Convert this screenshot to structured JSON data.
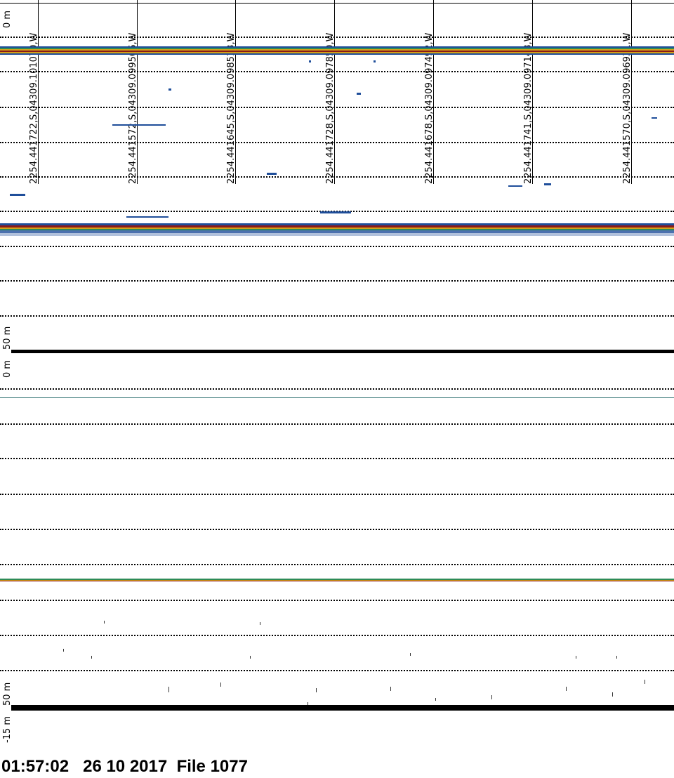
{
  "panel_top": {
    "depth_top_label": "0  m",
    "depth_bottom_label": "50  m"
  },
  "panel_bottom": {
    "depth_top_label": "0  m",
    "depth_bottom_label": "50  m",
    "offset_label": "-15  m"
  },
  "gps_marks": [
    "2254.441722,S,04309.101070,W",
    "2254.441572,S,04309.099566,W",
    "2254.441645,S,04309.098513,W",
    "2254.441728,S,04309.097850,W",
    "2254.441678,S,04309.097492,W",
    "2254.441741,S,04309.097148,W",
    "2254.441570,S,04309.096931,W"
  ],
  "footer": {
    "time": "01:57:02",
    "date": "26 10 2017",
    "file": "File 1077"
  },
  "colors": {
    "echo_strong": "#8b1a1a",
    "echo_mid": "#d4a017",
    "echo_weak": "#1f4e9a",
    "echo_green": "#2e8b57"
  }
}
